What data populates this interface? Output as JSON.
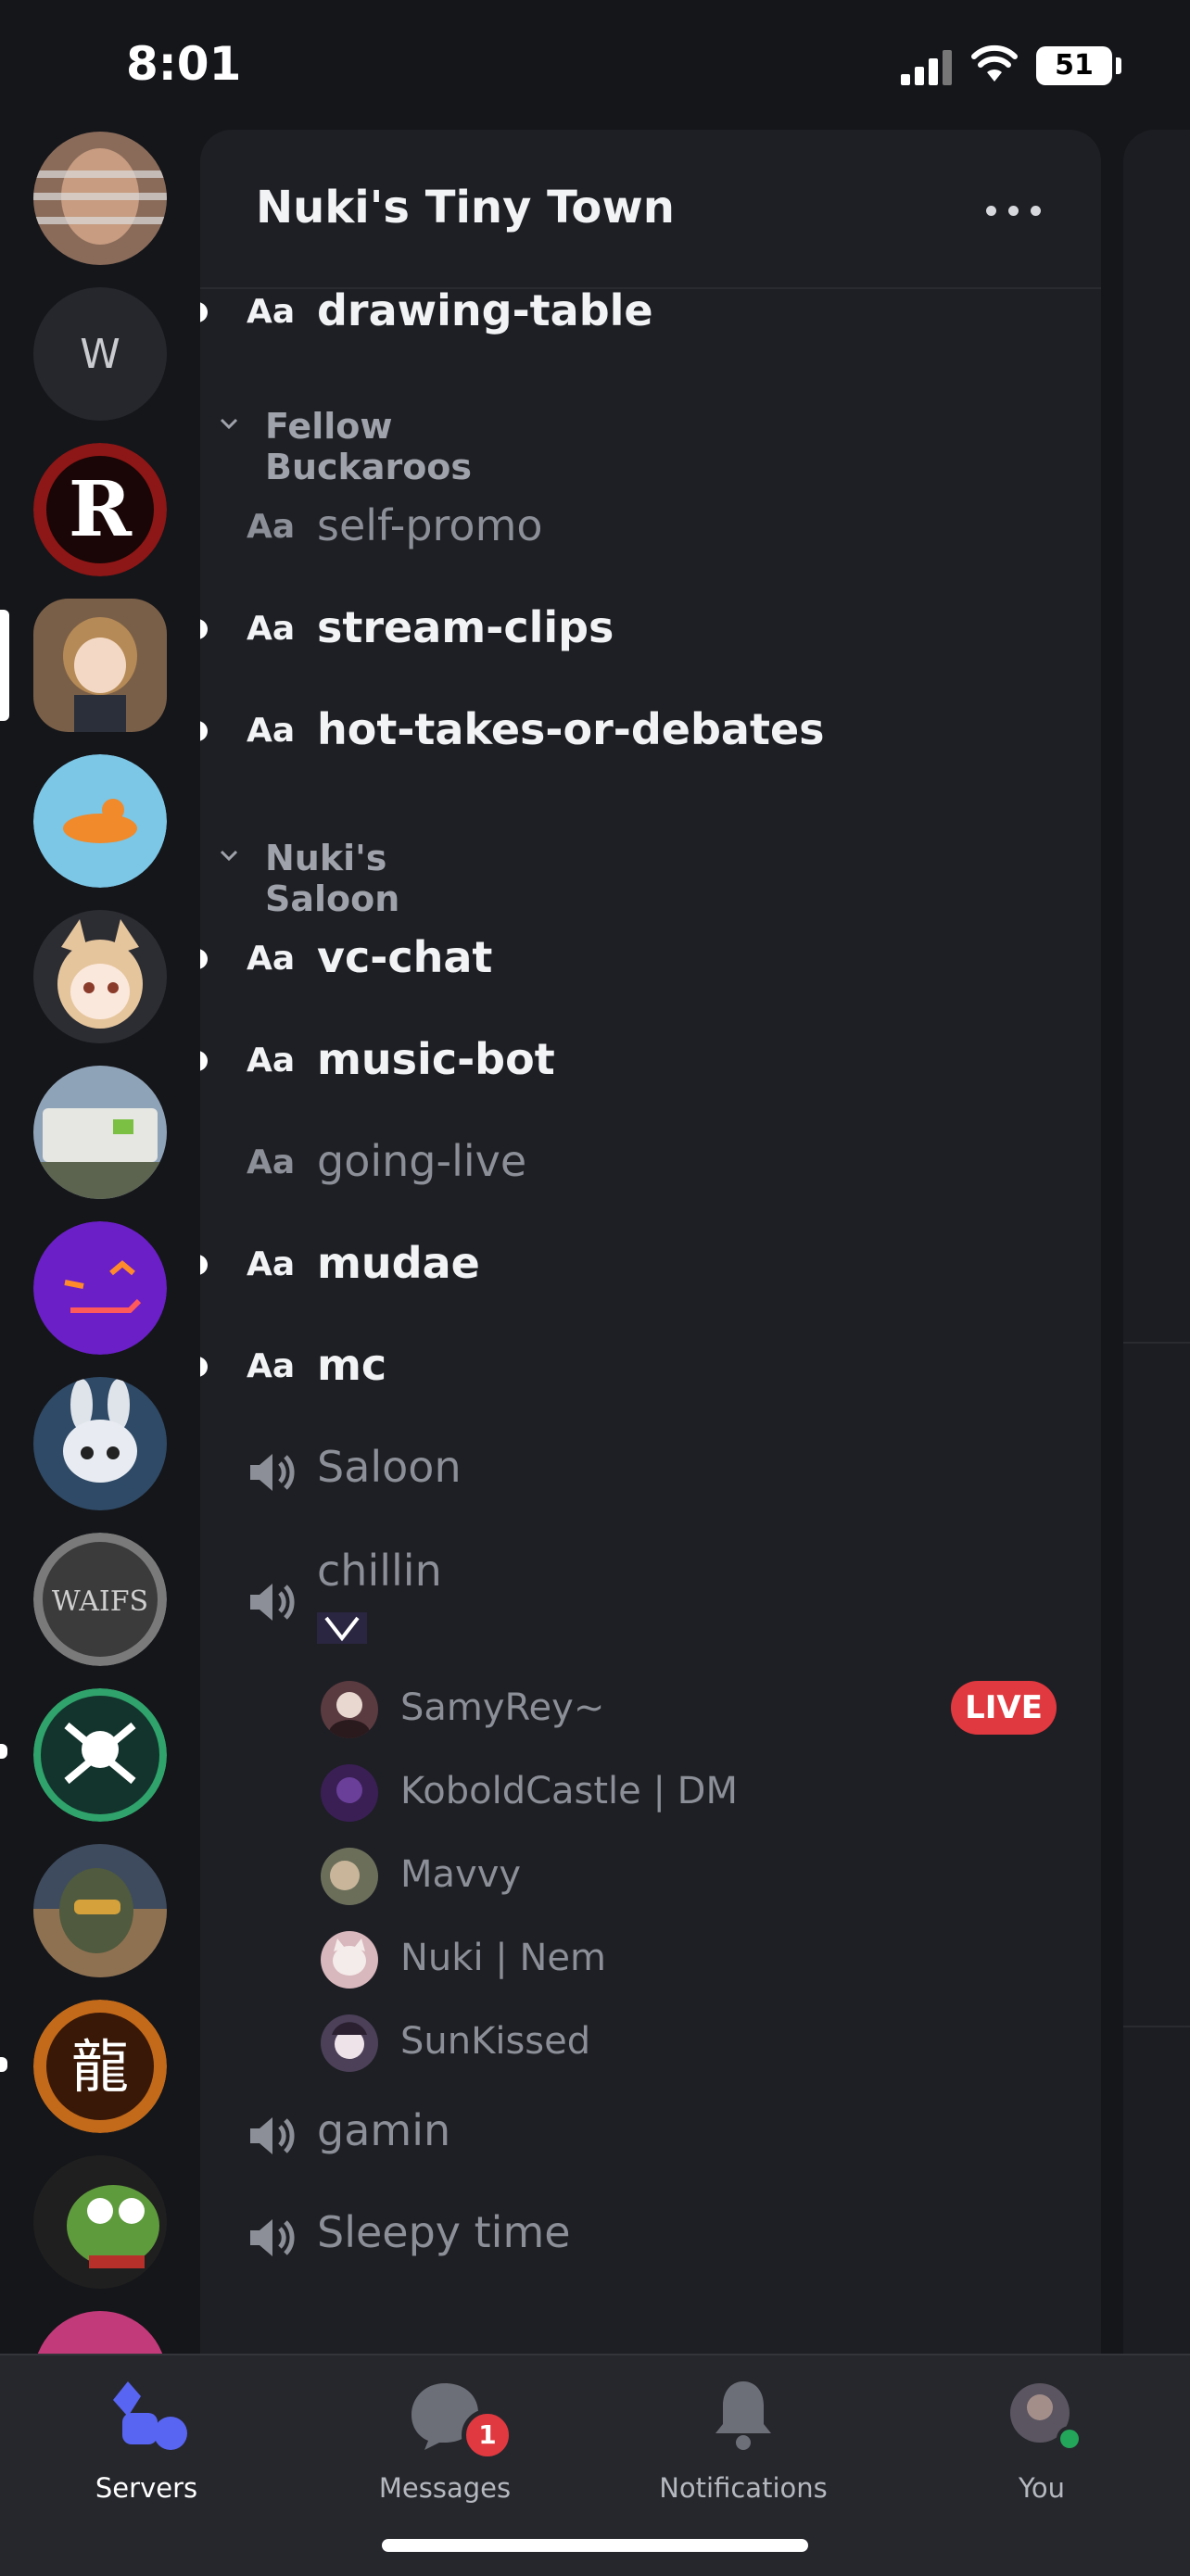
{
  "status_bar": {
    "time": "8:01",
    "battery": "51"
  },
  "server": {
    "name": "Nuki's Tiny Town"
  },
  "channels": [
    {
      "prefix": "Aa",
      "name": "drawing-table",
      "state": "unread"
    },
    {
      "category": "Fellow Buckaroos"
    },
    {
      "prefix": "Aa",
      "name": "self-promo",
      "state": "read"
    },
    {
      "prefix": "Aa",
      "name": "stream-clips",
      "state": "unread"
    },
    {
      "prefix": "Aa",
      "name": "hot-takes-or-debates",
      "state": "unread"
    },
    {
      "category": "Nuki's Saloon"
    },
    {
      "prefix": "Aa",
      "name": "vc-chat",
      "state": "unread"
    },
    {
      "prefix": "Aa",
      "name": "music-bot",
      "state": "unread"
    },
    {
      "prefix": "Aa",
      "name": "going-live",
      "state": "read"
    },
    {
      "prefix": "Aa",
      "name": "mudae",
      "state": "unread"
    },
    {
      "prefix": "Aa",
      "name": "mc",
      "state": "unread"
    },
    {
      "voice": "Saloon"
    },
    {
      "voice": "chillin"
    },
    {
      "voice": "gamin"
    },
    {
      "voice": "Sleepy time"
    }
  ],
  "voice_users": [
    {
      "name": "SamyRey~",
      "badge": "LIVE",
      "color": "#5a3b40"
    },
    {
      "name": "KoboldCastle | DM",
      "color": "#3a1f55"
    },
    {
      "name": "Mavvy",
      "color": "#6b6f5a"
    },
    {
      "name": "Nuki | Nem",
      "color": "#d8b7bd"
    },
    {
      "name": "SunKissed",
      "color": "#4b4058"
    }
  ],
  "servers": [
    {
      "icon": "bearded-man-avatar",
      "color": "#8a6b5a"
    },
    {
      "letter": "W"
    },
    {
      "icon": "red-r-logo",
      "color": "#8d1616"
    },
    {
      "icon": "anime-girl-avatar",
      "color": "#7a5f48",
      "selected": true
    },
    {
      "icon": "flat-mars-society-logo",
      "color": "#7cc6e6"
    },
    {
      "icon": "fox-girl-avatar",
      "color": "#e5c59c"
    },
    {
      "icon": "camper-trailer-photo",
      "color": "#8fa3b8"
    },
    {
      "icon": "purple-face-logo",
      "color": "#6a1fc7"
    },
    {
      "icon": "bunny-robot-avatar",
      "color": "#2f4a66"
    },
    {
      "icon": "the-waifs-logo",
      "color": "#7a7a7a"
    },
    {
      "icon": "skull-crossbones-logo",
      "color": "#12342c",
      "unread": true
    },
    {
      "icon": "soldier-helmet-avatar",
      "color": "#3e4b5e"
    },
    {
      "icon": "dragon-kanji-logo",
      "color": "#9a4a12",
      "unread": true
    },
    {
      "icon": "pepe-frog-avatar",
      "color": "#35503a"
    }
  ],
  "tabs": [
    {
      "label": "Servers",
      "active": true
    },
    {
      "label": "Messages",
      "badge": "1"
    },
    {
      "label": "Notifications"
    },
    {
      "label": "You"
    }
  ],
  "colors": {
    "accent": "#5865f2",
    "live": "#e0393f",
    "panel": "#1e1f24",
    "online": "#23a55a"
  }
}
